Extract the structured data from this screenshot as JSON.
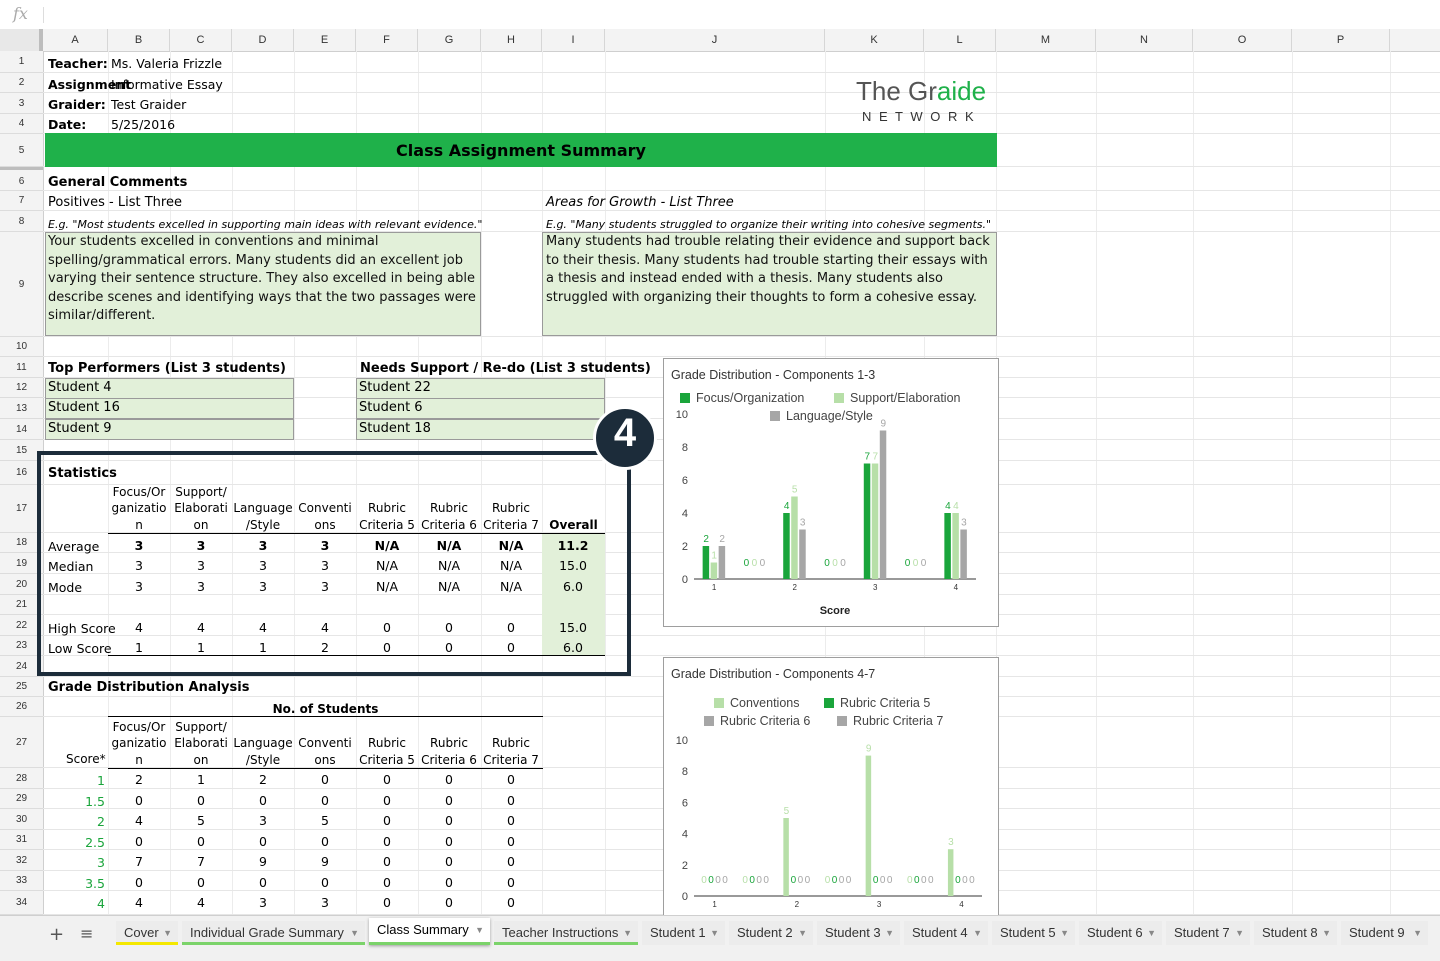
{
  "formula_bar": {
    "fx": "fx"
  },
  "columns": [
    "A",
    "B",
    "C",
    "D",
    "E",
    "F",
    "G",
    "H",
    "I",
    "J",
    "K",
    "L",
    "M",
    "N",
    "O",
    "P"
  ],
  "rows": [
    "1",
    "2",
    "3",
    "4",
    "5",
    "6",
    "7",
    "8",
    "9",
    "10",
    "11",
    "12",
    "13",
    "14",
    "15",
    "16",
    "17",
    "18",
    "19",
    "20",
    "21",
    "22",
    "23",
    "24",
    "25",
    "26",
    "27",
    "28",
    "29",
    "30",
    "31",
    "32",
    "33",
    "34"
  ],
  "info": {
    "teacher_label": "Teacher:",
    "teacher": "Ms. Valeria Frizzle",
    "assignment_label": "Assignment",
    "assignment": "Informative Essay",
    "graider_label": "Graider:",
    "graider": "Test Graider",
    "date_label": "Date:",
    "date": "5/25/2016"
  },
  "logo": {
    "line1": "The Graide",
    "line2": "N E T W O R K"
  },
  "banner": "Class Assignment Summary",
  "comments": {
    "title": "General Comments",
    "positives_title": "Positives - List Three",
    "positives_eg": "E.g. \"Most students excelled in supporting main ideas with relevant evidence.\"",
    "positives_text": "Your students excelled in conventions and minimal spelling/grammatical errors. Many students did an excellent job varying their sentence structure. They also excelled in being able describe scenes and identifying ways that the two passages were similar/different.",
    "growth_title": "Areas for Growth - List Three",
    "growth_eg": "E.g. \"Many students struggled to organize their writing into cohesive segments.\"",
    "growth_text": "Many students had trouble relating their evidence and support back to their thesis. Many students had trouble starting their essays with a thesis and instead ended with a thesis. Many students also struggled with organizing their thoughts to form a cohesive essay."
  },
  "top": {
    "title": "Top Performers (List 3 students)",
    "students": [
      "Student 4",
      "Student 16",
      "Student 9"
    ]
  },
  "support": {
    "title": "Needs Support / Re-do (List 3 students)",
    "students": [
      "Student 22",
      "Student 6",
      "Student 18"
    ]
  },
  "badge": "4",
  "stats": {
    "title": "Statistics",
    "headers": [
      "Focus/Or\nganizatio\nn",
      "Support/\nElaborati\non",
      "Language\n/Style",
      "Conventi\nons",
      "Rubric\nCriteria 5",
      "Rubric\nCriteria 6",
      "Rubric\nCriteria 7"
    ],
    "overall": "Overall",
    "rows": [
      {
        "label": "Average",
        "values": [
          "3",
          "3",
          "3",
          "3",
          "N/A",
          "N/A",
          "N/A"
        ],
        "overall": "11.2",
        "bold": true
      },
      {
        "label": "Median",
        "values": [
          "3",
          "3",
          "3",
          "3",
          "N/A",
          "N/A",
          "N/A"
        ],
        "overall": "15.0",
        "bold": false
      },
      {
        "label": "Mode",
        "values": [
          "3",
          "3",
          "3",
          "3",
          "N/A",
          "N/A",
          "N/A"
        ],
        "overall": "6.0",
        "bold": false
      },
      {
        "label": "High Score",
        "values": [
          "4",
          "4",
          "4",
          "4",
          "0",
          "0",
          "0"
        ],
        "overall": "15.0",
        "bold": false
      },
      {
        "label": "Low Score",
        "values": [
          "1",
          "1",
          "1",
          "2",
          "0",
          "0",
          "0"
        ],
        "overall": "6.0",
        "bold": false
      }
    ]
  },
  "gda": {
    "title": "Grade Distribution Analysis",
    "subtitle": "No. of Students",
    "score_label": "Score*",
    "headers": [
      "Focus/Or\nganizatio\nn",
      "Support/\nElaborati\non",
      "Language\n/Style",
      "Conventi\nons",
      "Rubric\nCriteria 5",
      "Rubric\nCriteria 6",
      "Rubric\nCriteria 7"
    ],
    "rows": [
      {
        "score": "1",
        "values": [
          "2",
          "1",
          "2",
          "0",
          "0",
          "0",
          "0"
        ]
      },
      {
        "score": "1.5",
        "values": [
          "0",
          "0",
          "0",
          "0",
          "0",
          "0",
          "0"
        ]
      },
      {
        "score": "2",
        "values": [
          "4",
          "5",
          "3",
          "5",
          "0",
          "0",
          "0"
        ]
      },
      {
        "score": "2.5",
        "values": [
          "0",
          "0",
          "0",
          "0",
          "0",
          "0",
          "0"
        ]
      },
      {
        "score": "3",
        "values": [
          "7",
          "7",
          "9",
          "9",
          "0",
          "0",
          "0"
        ]
      },
      {
        "score": "3.5",
        "values": [
          "0",
          "0",
          "0",
          "0",
          "0",
          "0",
          "0"
        ]
      },
      {
        "score": "4",
        "values": [
          "4",
          "4",
          "3",
          "3",
          "0",
          "0",
          "0"
        ]
      }
    ]
  },
  "chart_data": [
    {
      "type": "bar",
      "title": "Grade Distribution - Components 1-3",
      "xlabel": "Score",
      "ylabel": "",
      "categories": [
        "1",
        "",
        "2",
        "",
        "3",
        "",
        "4"
      ],
      "tick_labels": [
        "1",
        "2",
        "3",
        "4"
      ],
      "ylim": [
        0,
        10
      ],
      "yticks": [
        "0",
        "2",
        "4",
        "6",
        "8",
        "10"
      ],
      "colors": [
        "#1aa53b",
        "#b7dfa8",
        "#a6a6a6"
      ],
      "series": [
        {
          "name": "Focus/Organization",
          "values": [
            2,
            0,
            4,
            0,
            7,
            0,
            4
          ]
        },
        {
          "name": "Support/Elaboration",
          "values": [
            1,
            0,
            5,
            0,
            7,
            0,
            4
          ]
        },
        {
          "name": "Language/Style",
          "values": [
            2,
            0,
            3,
            0,
            9,
            0,
            3
          ]
        }
      ]
    },
    {
      "type": "bar",
      "title": "Grade Distribution - Components 4-7",
      "xlabel": "",
      "ylabel": "",
      "categories": [
        "1",
        "",
        "2",
        "",
        "3",
        "",
        "4"
      ],
      "tick_labels": [
        "1",
        "2",
        "3",
        "4"
      ],
      "ylim": [
        0,
        10
      ],
      "yticks": [
        "0",
        "2",
        "4",
        "6",
        "8",
        "10"
      ],
      "colors": [
        "#b7dfa8",
        "#1aa53b",
        "#a6a6a6",
        "#a6a6a6"
      ],
      "series": [
        {
          "name": "Conventions",
          "values": [
            0,
            0,
            5,
            0,
            9,
            0,
            3
          ]
        },
        {
          "name": "Rubric Criteria 5",
          "values": [
            0,
            0,
            0,
            0,
            0,
            0,
            0
          ]
        },
        {
          "name": "Rubric Criteria 6",
          "values": [
            0,
            0,
            0,
            0,
            0,
            0,
            0
          ]
        },
        {
          "name": "Rubric Criteria 7",
          "values": [
            0,
            0,
            0,
            0,
            0,
            0,
            0
          ]
        }
      ]
    }
  ],
  "tabs": {
    "add": "+",
    "menu": "≡",
    "items": [
      {
        "label": "Cover",
        "color": "#f4e800"
      },
      {
        "label": "Individual Grade Summary",
        "color": "#7bd36a"
      },
      {
        "label": "Class Summary",
        "color": "#7bd36a",
        "active": true
      },
      {
        "label": "Teacher Instructions",
        "color": "#7bd36a"
      },
      {
        "label": "Student 1",
        "color": ""
      },
      {
        "label": "Student 2",
        "color": ""
      },
      {
        "label": "Student 3",
        "color": ""
      },
      {
        "label": "Student 4",
        "color": ""
      },
      {
        "label": "Student 5",
        "color": ""
      },
      {
        "label": "Student 6",
        "color": ""
      },
      {
        "label": "Student 7",
        "color": ""
      },
      {
        "label": "Student 8",
        "color": ""
      },
      {
        "label": "Student 9",
        "color": ""
      }
    ]
  }
}
